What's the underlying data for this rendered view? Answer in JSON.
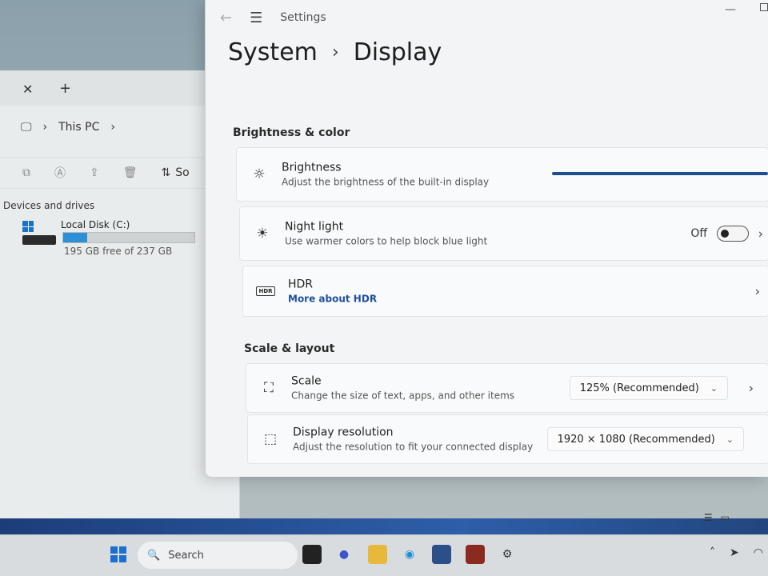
{
  "explorer": {
    "breadcrumb_item": "This PC",
    "toolbar_sort_label": "So",
    "section_title": "Devices and drives",
    "drive": {
      "name": "Local Disk (C:)",
      "free_text": "195 GB free of 237 GB",
      "used_fraction": 0.18
    }
  },
  "settings": {
    "app_title": "Settings",
    "breadcrumb": {
      "parent": "System",
      "current": "Display"
    },
    "brightness_color": {
      "title": "Brightness & color",
      "brightness": {
        "title": "Brightness",
        "description": "Adjust the brightness of the built-in display"
      },
      "night_light": {
        "title": "Night light",
        "description": "Use warmer colors to help block blue light",
        "state": "Off"
      },
      "hdr": {
        "badge": "HDR",
        "title": "HDR",
        "link": "More about HDR"
      }
    },
    "scale_layout": {
      "title": "Scale & layout",
      "scale": {
        "title": "Scale",
        "description": "Change the size of text, apps, and other items",
        "value": "125% (Recommended)"
      },
      "resolution": {
        "title": "Display resolution",
        "description": "Adjust the resolution to fit your connected display",
        "value": "1920 × 1080 (Recommended)"
      }
    }
  },
  "taskbar": {
    "search_placeholder": "Search"
  },
  "colors": {
    "accent": "#1f4e8c",
    "link": "#1e4f9e",
    "drive_fill": "#2d8fd5"
  }
}
